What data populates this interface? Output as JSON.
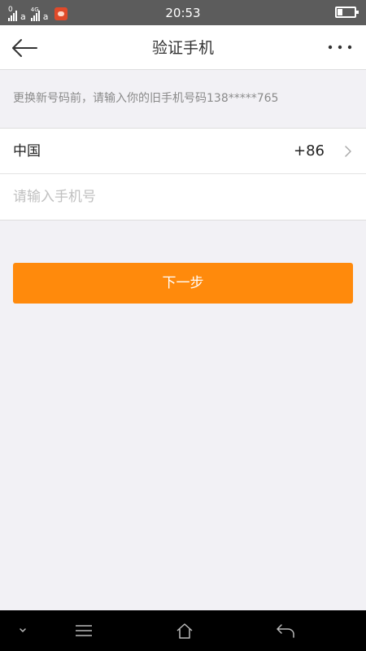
{
  "status_bar": {
    "time": "20:53",
    "sim1_mark": "0",
    "sim1_letter": "a",
    "sim2_mark": "4G",
    "sim2_letter": "a",
    "battery_level": 0.3
  },
  "nav": {
    "title": "验证手机"
  },
  "hint": "更换新号码前，请输入你的旧手机号码138*****765",
  "form": {
    "country_name": "中国",
    "country_code": "+86",
    "phone_placeholder": "请输入手机号",
    "phone_value": ""
  },
  "next_button_label": "下一步",
  "colors": {
    "accent": "#ff8a0c",
    "background": "#f2f1f5",
    "status_bar": "#5c5c5c"
  },
  "icons": {
    "back": "arrow-left-icon",
    "more": "more-dots-icon",
    "chevron": "chevron-right-icon",
    "sys_collapse": "chevron-down-icon",
    "sys_menu": "menu-icon",
    "sys_home": "home-icon",
    "sys_back": "return-icon"
  }
}
